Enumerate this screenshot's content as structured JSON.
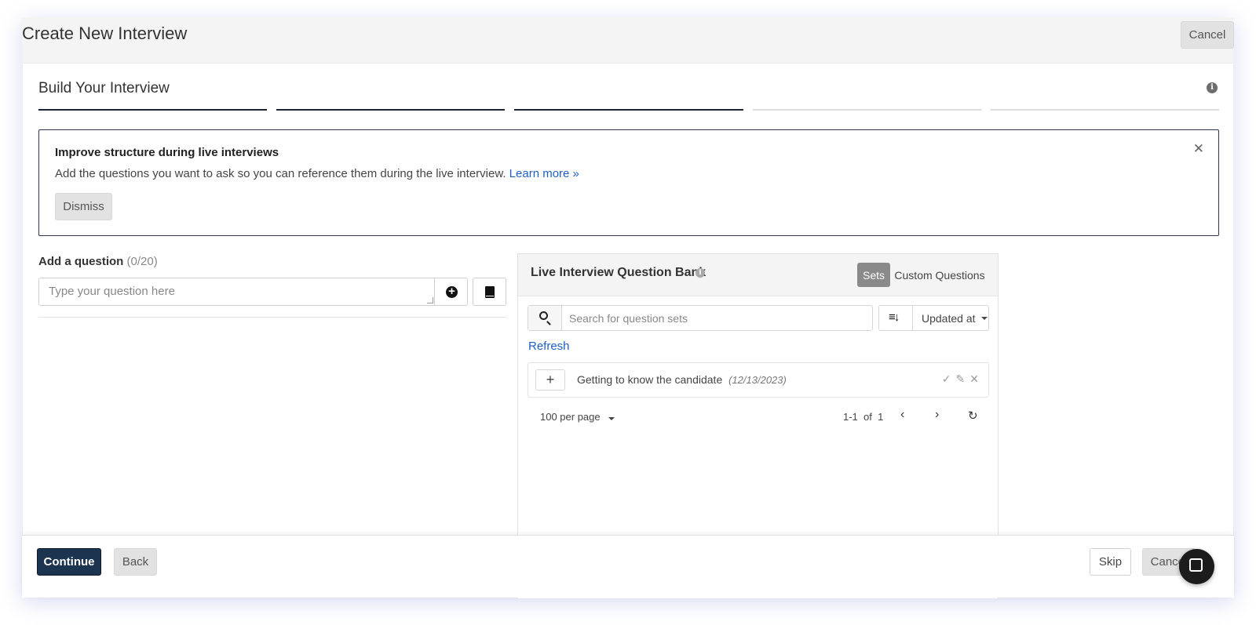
{
  "modal": {
    "title": "Create New Interview",
    "cancel_label": "Cancel"
  },
  "build": {
    "title": "Build Your Interview",
    "info_icon": "info-icon",
    "steps_total": 5,
    "steps_completed": 3
  },
  "callout": {
    "title": "Improve structure during live interviews",
    "text": "Add the questions you want to ask so you can reference them during the live interview.",
    "link": "Learn more »",
    "close_glyph": "✕",
    "dismiss_label": "Dismiss"
  },
  "add_question": {
    "label": "Add a question",
    "count": "(0/20)",
    "placeholder": "Type your question here",
    "add_icon": "plus-circle-icon",
    "bank_icon": "book-icon"
  },
  "bank": {
    "title": "Live Interview Question Bank",
    "tabs": {
      "sets": "Sets",
      "custom": "Custom Questions"
    },
    "active_tab": "Sets",
    "search_placeholder": "Search for question sets",
    "sort_label": "Updated at",
    "refresh_label": "Refresh",
    "sets": [
      {
        "name": "Getting to know the candidate",
        "date": "(12/13/2023)"
      }
    ],
    "pagination": {
      "per_page": "100 per page",
      "range": "1-1",
      "of": "of",
      "total": "1"
    }
  },
  "footer": {
    "continue_label": "Continue",
    "back_label": "Back",
    "skip_label": "Skip",
    "cancel_label": "Cancel"
  },
  "colors": {
    "primary": "#1d3451",
    "link": "#1f5fc6",
    "step_done": "#1a2236",
    "step_pending": "#dcdcdc"
  }
}
